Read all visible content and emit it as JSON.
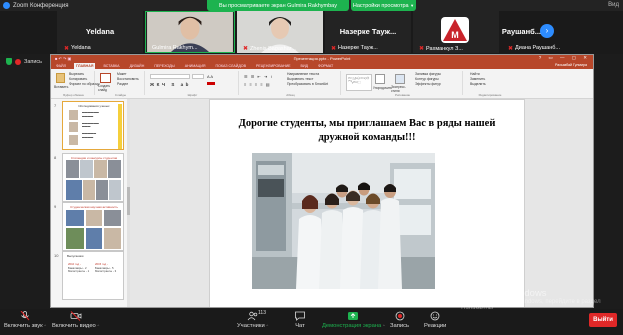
{
  "zoom": {
    "app_title": "Zoom Конференция",
    "share_banner": "Вы просматриваете экран Gulmira Rakhymbay",
    "view_options": "Настройки просмотра",
    "window_controls": [
      "Вид"
    ],
    "next_page_icon": "chevron-right-icon"
  },
  "participants": [
    {
      "display": "Yeldana",
      "label": "Yeldana",
      "muted": true
    },
    {
      "display": "",
      "label": "Gulmira Rakhym...",
      "muted": false,
      "video": true
    },
    {
      "display": "",
      "label": "Zhenis Bagashar...",
      "muted": true,
      "video": true
    },
    {
      "display": "Назерке Тауж...",
      "label": "Назерке Тауж...",
      "muted": true
    },
    {
      "display": "",
      "label": "Рахманкул З...",
      "muted": true,
      "avatar": true
    },
    {
      "display": "Диана Раушанб...",
      "label": "Диана Раушанб...",
      "muted": true
    }
  ],
  "recording": {
    "label": "Запись"
  },
  "powerpoint": {
    "title": "Презентация.pptx - PowerPoint",
    "user": "Рахымбай Гулмира",
    "tabs": [
      "ФАЙЛ",
      "ГЛАВНАЯ",
      "ВСТАВКА",
      "ДИЗАЙН",
      "ПЕРЕХОДЫ",
      "АНИМАЦИЯ",
      "ПОКАЗ СЛАЙДОВ",
      "РЕЦЕНЗИРОВАНИЕ",
      "ВИД",
      "ФОРМАТ"
    ],
    "active_tab": "ГЛАВНАЯ",
    "ribbon": {
      "clipboard": {
        "paste": "Вставить",
        "cut": "Вырезать",
        "copy": "Копировать",
        "painter": "Формат по образцу",
        "group": "Буфер обмена"
      },
      "slides": {
        "new": "Создать слайд",
        "layout": "Макет",
        "reset": "Восстановить",
        "section": "Раздел",
        "group": "Слайды"
      },
      "font": {
        "group": "Шрифт"
      },
      "paragraph": {
        "direction": "Направление текста",
        "align": "Выровнять текст",
        "smartart": "Преобразовать в SmartArt",
        "group": "Абзац"
      },
      "drawing": {
        "arrange": "Упорядочить",
        "styles": "Экспресс-стили",
        "fill": "Заливка фигуры",
        "outline": "Контур фигуры",
        "effects": "Эффекты фигур",
        "group": "Рисование"
      },
      "editing": {
        "find": "Найти",
        "replace": "Заменить",
        "select": "Выделить",
        "group": "Редактирование"
      }
    },
    "thumbnails": [
      {
        "num": "7",
        "title": "Исследования ученых",
        "selected": true
      },
      {
        "num": "8",
        "title": "Стипендии и конкурсы студентов"
      },
      {
        "num": "9",
        "title": "Студенческая научная активность"
      },
      {
        "num": "10",
        "title": "Выпускники",
        "lines": [
          "2010 год -",
          "Бакалавры - 2",
          "Магистранты - 1",
          "2015 год -",
          "Бакалавры - 5",
          "Магистранты - 3"
        ]
      }
    ],
    "slide": {
      "title": "Дорогие студенты, мы приглашаем Вас в ряды нашей дружной команды!!!"
    }
  },
  "watermark": {
    "line1": "Активация Windows",
    "line2": "Чтобы активировать Windows, перейдите в раздел \"Параметры\"."
  },
  "toolbar": {
    "mute": "Включить звук",
    "video": "Включить видео",
    "participants": "Участники",
    "participants_count": "113",
    "chat": "Чат",
    "share": "Демонстрация экрана",
    "record": "Запись",
    "reactions": "Реакции",
    "end": "Выйти"
  }
}
